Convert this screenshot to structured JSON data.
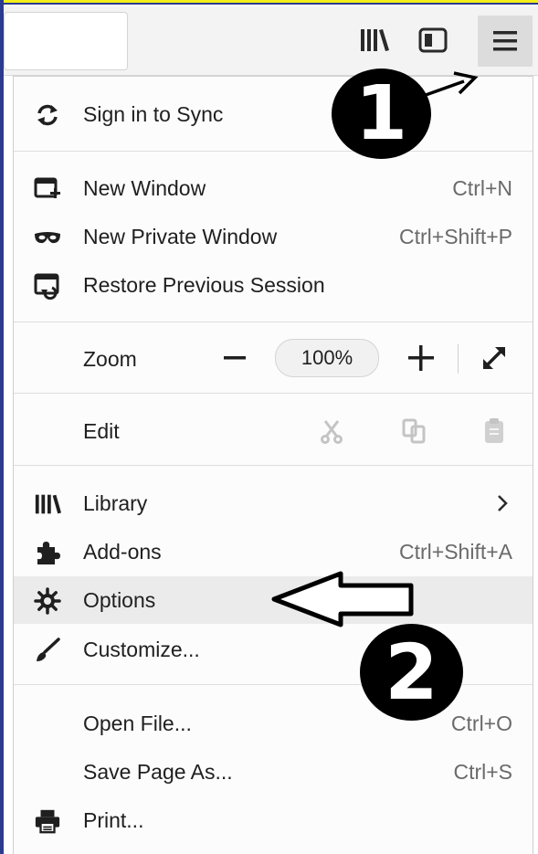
{
  "menu": {
    "sign_in": {
      "label": "Sign in to Sync",
      "icon": "sync-icon"
    },
    "new_window": {
      "label": "New Window",
      "shortcut": "Ctrl+N",
      "icon": "new-window-icon"
    },
    "new_private": {
      "label": "New Private Window",
      "shortcut": "Ctrl+Shift+P",
      "icon": "private-mask-icon"
    },
    "restore": {
      "label": "Restore Previous Session",
      "icon": "restore-session-icon"
    },
    "zoom": {
      "label": "Zoom",
      "minus": "−",
      "value": "100%",
      "plus": "+",
      "icon_full": "fullscreen-icon"
    },
    "edit": {
      "label": "Edit",
      "icons": [
        "cut-icon",
        "copy-icon",
        "paste-icon"
      ]
    },
    "library": {
      "label": "Library",
      "icon": "library-icon",
      "arrow": "chevron-right-icon"
    },
    "addons": {
      "label": "Add-ons",
      "shortcut": "Ctrl+Shift+A",
      "icon": "puzzle-icon"
    },
    "options": {
      "label": "Options",
      "icon": "gear-icon"
    },
    "customize": {
      "label": "Customize...",
      "icon": "brush-icon"
    },
    "open_file": {
      "label": "Open File...",
      "shortcut": "Ctrl+O"
    },
    "save_page": {
      "label": "Save Page As...",
      "shortcut": "Ctrl+S"
    },
    "print": {
      "label": "Print...",
      "icon": "printer-icon"
    }
  },
  "annotations": {
    "badge1": "1",
    "badge2": "2"
  },
  "colors": {
    "highlight": "#ebebeb",
    "window_border": "#2b3b8e",
    "top_accent": "#f3ee1a"
  }
}
